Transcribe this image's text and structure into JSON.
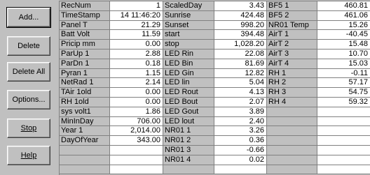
{
  "buttons": [
    {
      "label": "Add...",
      "name": "add-button"
    },
    {
      "label": "Delete",
      "name": "delete-button"
    },
    {
      "label": "Delete All",
      "name": "delete-all-button"
    },
    {
      "label": "Options...",
      "name": "options-button"
    },
    {
      "label": "Stop",
      "name": "stop-button"
    },
    {
      "label": "Help",
      "name": "help-button"
    }
  ],
  "columns": [
    {
      "rows": [
        {
          "name": "RecNum",
          "value": "1"
        },
        {
          "name": "TimeStamp",
          "value": "14 11:46:20"
        },
        {
          "name": "Panel  T",
          "value": "21.29"
        },
        {
          "name": "Batt  Volt",
          "value": "11.59"
        },
        {
          "name": "Pricip  mm",
          "value": "0.00"
        },
        {
          "name": "ParUp  1",
          "value": "2.88"
        },
        {
          "name": "ParDn  1",
          "value": "0.18"
        },
        {
          "name": "Pyran  1",
          "value": "1.15"
        },
        {
          "name": "NetRad  1",
          "value": "2.14"
        },
        {
          "name": "TAir  1old",
          "value": "0.00"
        },
        {
          "name": "RH  1old",
          "value": "0.00"
        },
        {
          "name": "sys  volt1",
          "value": "1.86"
        },
        {
          "name": "MinInDay",
          "value": "706.00"
        },
        {
          "name": "Year  1",
          "value": "2,014.00"
        },
        {
          "name": "DayOfYear",
          "value": "343.00"
        },
        {
          "name": "",
          "value": ""
        },
        {
          "name": "",
          "value": ""
        },
        {
          "name": "",
          "value": ""
        }
      ]
    },
    {
      "rows": [
        {
          "name": "ScaledDay",
          "value": "3.43"
        },
        {
          "name": "Sunrise",
          "value": "424.48"
        },
        {
          "name": "Sunset",
          "value": "998.20"
        },
        {
          "name": "start",
          "value": "394.48"
        },
        {
          "name": "stop",
          "value": "1,028.20"
        },
        {
          "name": "LED  Rin",
          "value": "22.08"
        },
        {
          "name": "LED  Bin",
          "value": "81.69"
        },
        {
          "name": "LED  Gin",
          "value": "12.82"
        },
        {
          "name": "LED  lin",
          "value": "5.04"
        },
        {
          "name": "LED  Rout",
          "value": "4.13"
        },
        {
          "name": "LED  Bout",
          "value": "2.07"
        },
        {
          "name": "LED  Gout",
          "value": "3.89"
        },
        {
          "name": "LED  lout",
          "value": "2.40"
        },
        {
          "name": "NR01  1",
          "value": "3.26"
        },
        {
          "name": "NR01  2",
          "value": "0.36"
        },
        {
          "name": "NR01  3",
          "value": "-0.66"
        },
        {
          "name": "NR01  4",
          "value": "0.02"
        },
        {
          "name": "",
          "value": ""
        }
      ]
    },
    {
      "rows": [
        {
          "name": "BF5  1",
          "value": "460.81"
        },
        {
          "name": "BF5  2",
          "value": "461.06"
        },
        {
          "name": "NR01  Temp",
          "value": "15.26"
        },
        {
          "name": "AirT  1",
          "value": "-40.45"
        },
        {
          "name": "AirT  2",
          "value": "15.48"
        },
        {
          "name": "AirT  3",
          "value": "10.70"
        },
        {
          "name": "AirT  4",
          "value": "15.03"
        },
        {
          "name": "RH  1",
          "value": "-0.11"
        },
        {
          "name": "RH  2",
          "value": "57.17"
        },
        {
          "name": "RH  3",
          "value": "54.75"
        },
        {
          "name": "RH  4",
          "value": "59.32"
        },
        {
          "name": "",
          "value": ""
        },
        {
          "name": "",
          "value": ""
        },
        {
          "name": "",
          "value": ""
        },
        {
          "name": "",
          "value": ""
        },
        {
          "name": "",
          "value": ""
        },
        {
          "name": "",
          "value": ""
        },
        {
          "name": "",
          "value": ""
        }
      ]
    }
  ]
}
